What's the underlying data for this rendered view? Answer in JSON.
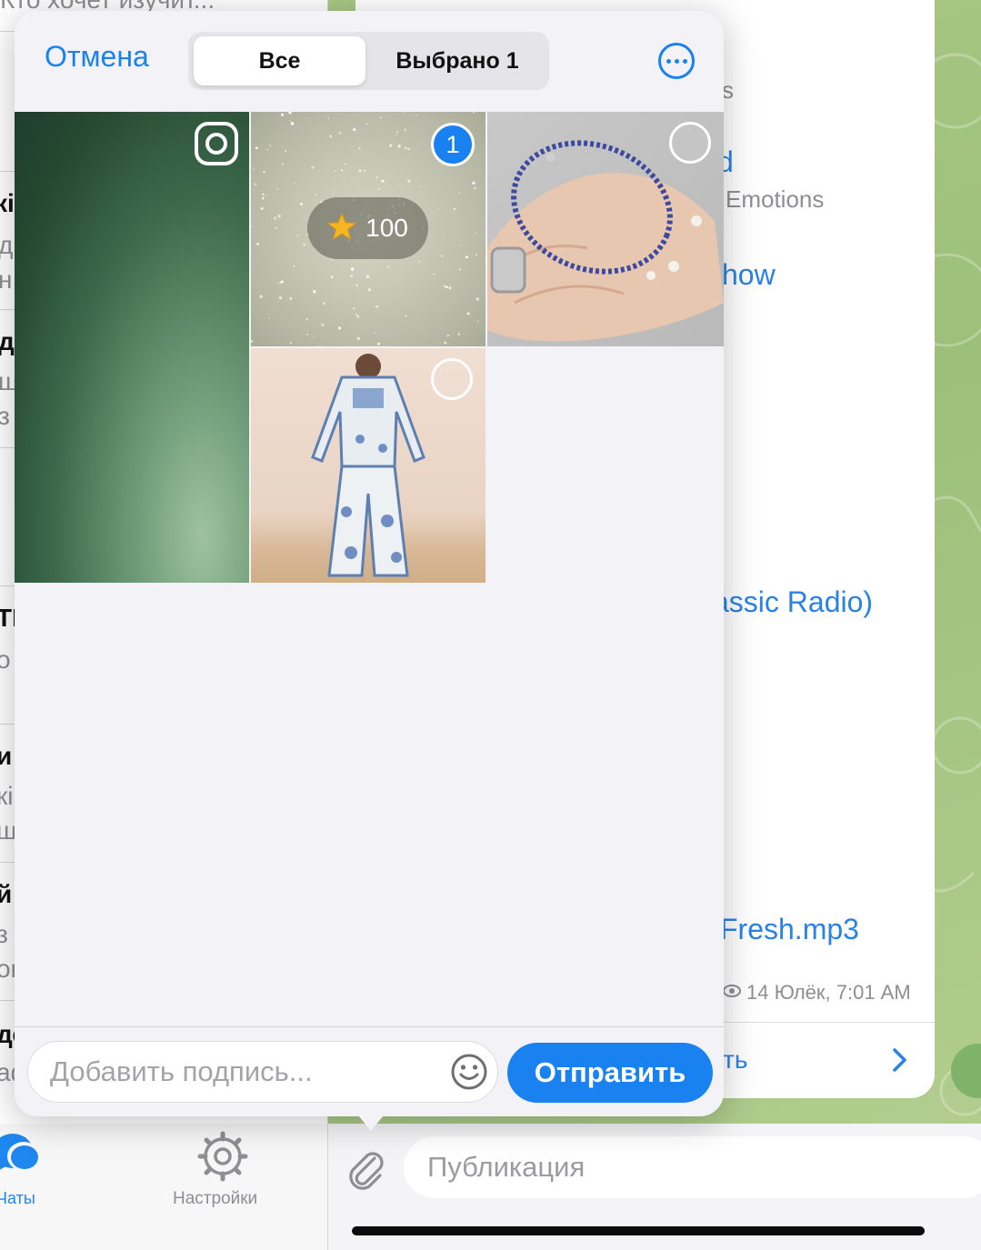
{
  "background": {
    "chat_list_fragments": {
      "top_preview": "Кто хочет изучит...",
      "r1a": "кі",
      "r1b": "д",
      "r1c": "н",
      "r2a": "д",
      "r2b": "щ",
      "r2c": "з",
      "r3a": "ТІ",
      "r3b": "о",
      "r4a": "и",
      "r4b": "кі",
      "r4c": "щ",
      "r5a": "й",
      "r5b": "з",
      "r5c": "он",
      "r6a": "дс",
      "r6b": "аф"
    },
    "info_card": {
      "frag_s": "s",
      "frag_d": "d",
      "emotions": "Emotions",
      "show": "how",
      "radio": "assic Radio)",
      "fresh": "Fresh.mp3",
      "views_date": "14 Юлёк, 7:01 AM",
      "footer_frag": "ть"
    },
    "tab_bar": {
      "chats_label": "Чаты",
      "settings_label": "Настройки"
    },
    "composer": {
      "placeholder": "Публикация"
    }
  },
  "picker": {
    "cancel_label": "Отмена",
    "segments": {
      "all": "Все",
      "selected": "Выбрано 1"
    },
    "media": [
      {
        "id": "tile-1",
        "description_icon": "instagram-icon"
      },
      {
        "id": "tile-2",
        "selected_index": "1",
        "stars": "100"
      },
      {
        "id": "tile-3",
        "selected": false
      },
      {
        "id": "tile-4",
        "selected": false
      }
    ],
    "caption_placeholder": "Добавить подпись...",
    "send_label": "Отправить"
  },
  "colors": {
    "accent": "#1a82f0",
    "chat_green": "#a9c985"
  }
}
